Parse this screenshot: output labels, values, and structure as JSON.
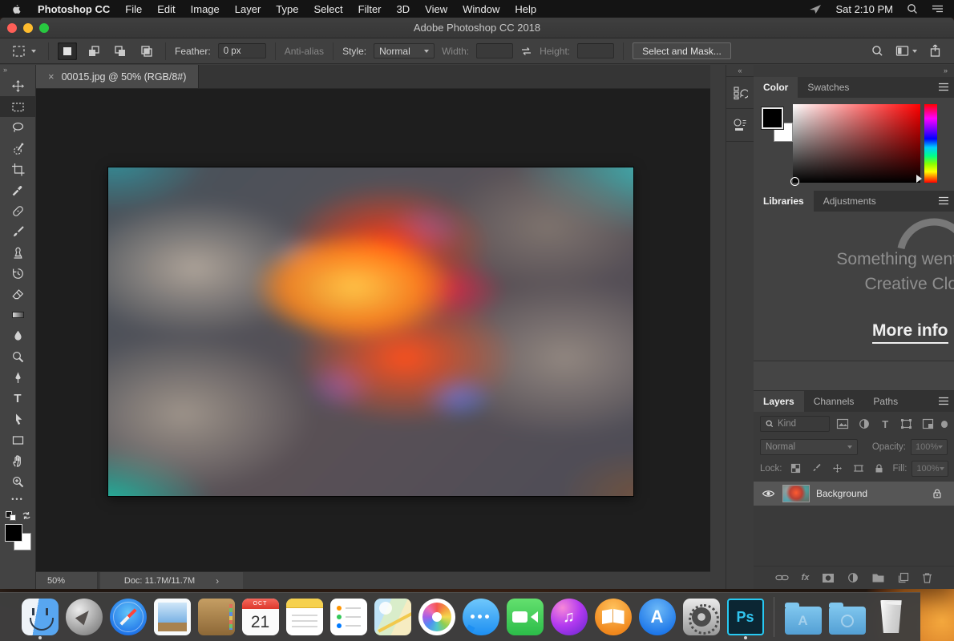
{
  "menubar": {
    "app": "Photoshop CC",
    "items": [
      "File",
      "Edit",
      "Image",
      "Layer",
      "Type",
      "Select",
      "Filter",
      "3D",
      "View",
      "Window",
      "Help"
    ],
    "clock": "Sat 2:10 PM"
  },
  "window": {
    "title": "Adobe Photoshop CC 2018"
  },
  "options_bar": {
    "feather_label": "Feather:",
    "feather_value": "0 px",
    "antialias_label": "Anti-alias",
    "style_label": "Style:",
    "style_value": "Normal",
    "width_label": "Width:",
    "width_value": "",
    "height_label": "Height:",
    "height_value": "",
    "select_mask_label": "Select and Mask..."
  },
  "document": {
    "tab_title": "00015.jpg @ 50% (RGB/8#)",
    "zoom_level": "50%",
    "doc_info": "Doc: 11.7M/11.7M"
  },
  "tools": [
    "move",
    "rectangular-marquee",
    "lasso",
    "quick-selection",
    "crop",
    "eyedropper",
    "spot-healing-brush",
    "brush",
    "clone-stamp",
    "history-brush",
    "eraser",
    "gradient",
    "blur",
    "dodge",
    "pen",
    "type",
    "path-selection",
    "rectangle",
    "hand",
    "zoom",
    "edit-toolbar"
  ],
  "active_tool": "rectangular-marquee",
  "colors": {
    "foreground": "#000000",
    "background": "#ffffff",
    "accent_blue": "#27c9f2"
  },
  "panels": {
    "color": {
      "tabs": [
        "Color",
        "Swatches"
      ]
    },
    "libraries": {
      "tabs": [
        "Libraries",
        "Adjustments"
      ],
      "message_line1": "Something went",
      "message_line2": "Creative Clo",
      "link_label": "More info"
    },
    "layers": {
      "tabs": [
        "Layers",
        "Channels",
        "Paths"
      ],
      "filter_label": "Kind",
      "blend_mode": "Normal",
      "opacity_label": "Opacity:",
      "opacity_value": "100%",
      "lock_label": "Lock:",
      "fill_label": "Fill:",
      "fill_value": "100%",
      "layers": [
        {
          "name": "Background",
          "visible": true,
          "locked": true
        }
      ]
    }
  },
  "dock": {
    "icons": [
      "finder",
      "launchpad",
      "safari",
      "mail",
      "contacts",
      "calendar",
      "notes",
      "reminders",
      "maps",
      "photos",
      "messages",
      "facetime",
      "itunes",
      "books",
      "app-store",
      "system-preferences",
      "photoshop",
      "folder-applications",
      "folder-downloads",
      "trash"
    ],
    "running": [
      "finder",
      "photoshop"
    ],
    "calendar_month": "OCT",
    "calendar_day": "21",
    "photoshop_badge": "Ps"
  },
  "icons": {
    "chevron_left": "«",
    "chevron_right": "»",
    "tab_close": "×",
    "status_chevron": "›"
  }
}
